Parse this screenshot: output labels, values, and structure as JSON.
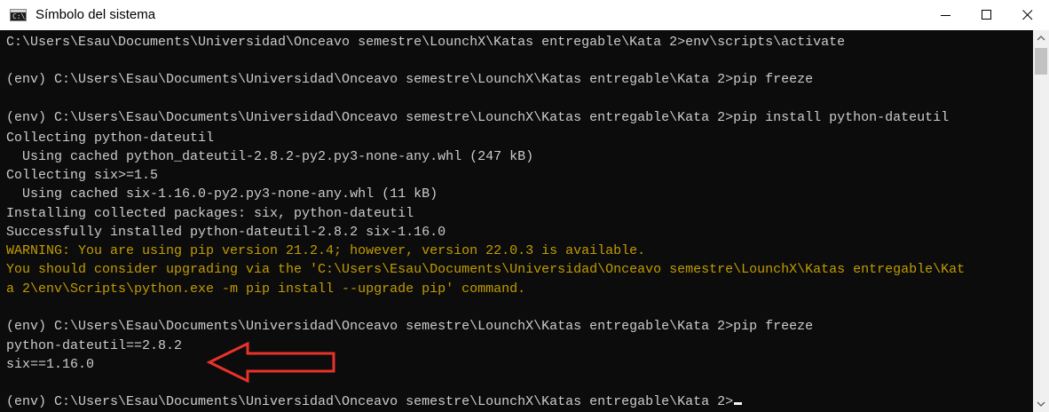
{
  "window": {
    "title": "Símbolo del sistema",
    "icon": "cmd-icon",
    "icon_glyph": "C:\\",
    "controls": [
      "minimize-icon",
      "maximize-icon",
      "close-icon"
    ]
  },
  "console": {
    "background": "#0c0c0c",
    "text_color": "#cccccc",
    "warning_color": "#c19c00",
    "lines": [
      "C:\\Users\\Esau\\Documents\\Universidad\\Onceavo semestre\\LounchX\\Katas entregable\\Kata 2>env\\scripts\\activate",
      "",
      "(env) C:\\Users\\Esau\\Documents\\Universidad\\Onceavo semestre\\LounchX\\Katas entregable\\Kata 2>pip freeze",
      "",
      "(env) C:\\Users\\Esau\\Documents\\Universidad\\Onceavo semestre\\LounchX\\Katas entregable\\Kata 2>pip install python-dateutil",
      "Collecting python-dateutil",
      "  Using cached python_dateutil-2.8.2-py2.py3-none-any.whl (247 kB)",
      "Collecting six>=1.5",
      "  Using cached six-1.16.0-py2.py3-none-any.whl (11 kB)",
      "Installing collected packages: six, python-dateutil",
      "Successfully installed python-dateutil-2.8.2 six-1.16.0",
      "WARNING: You are using pip version 21.2.4; however, version 22.0.3 is available.",
      "You should consider upgrading via the 'C:\\Users\\Esau\\Documents\\Universidad\\Onceavo semestre\\LounchX\\Katas entregable\\Kat",
      "a 2\\env\\Scripts\\python.exe -m pip install --upgrade pip' command.",
      "",
      "(env) C:\\Users\\Esau\\Documents\\Universidad\\Onceavo semestre\\LounchX\\Katas entregable\\Kata 2>pip freeze",
      "python-dateutil==2.8.2",
      "six==1.16.0",
      "",
      "(env) C:\\Users\\Esau\\Documents\\Universidad\\Onceavo semestre\\LounchX\\Katas entregable\\Kata 2>"
    ]
  },
  "annotation": {
    "shape": "arrow-outline-icon",
    "direction": "left",
    "color": "#e8322a"
  },
  "scrollbar": {
    "up_icon": "chevron-up-icon",
    "down_icon": "chevron-down-icon"
  }
}
